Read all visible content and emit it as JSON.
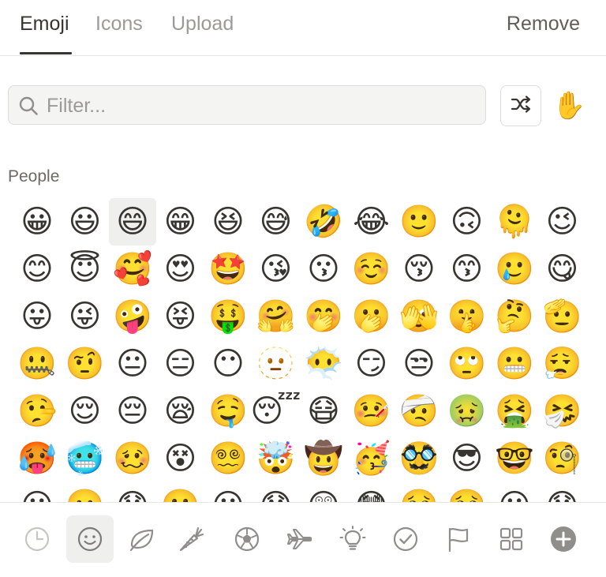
{
  "tabs": {
    "emoji": "Emoji",
    "icons": "Icons",
    "upload": "Upload",
    "remove": "Remove",
    "active": "emoji"
  },
  "filter": {
    "placeholder": "Filter...",
    "search_icon": "search-icon",
    "shuffle_icon": "shuffle-icon",
    "skin_tone_icon": "raised-hand-icon",
    "skin_tone_glyph": "✋"
  },
  "section": {
    "label": "People"
  },
  "emojis": [
    "😀",
    "😃",
    "😄",
    "😁",
    "😆",
    "😅",
    "🤣",
    "😂",
    "🙂",
    "🙃",
    "🫠",
    "😉",
    "😊",
    "😇",
    "🥰",
    "😍",
    "🤩",
    "😘",
    "😗",
    "☺️",
    "😚",
    "😙",
    "🥲",
    "😋",
    "😛",
    "😜",
    "🤪",
    "😝",
    "🤑",
    "🤗",
    "🤭",
    "🫢",
    "🫣",
    "🤫",
    "🤔",
    "🫡",
    "🤐",
    "🤨",
    "😐",
    "😑",
    "😶",
    "🫥",
    "😶‍🌫️",
    "😏",
    "😒",
    "🙄",
    "😬",
    "😮‍💨",
    "🤥",
    "😌",
    "😔",
    "😪",
    "🤤",
    "😴",
    "😷",
    "🤒",
    "🤕",
    "🤢",
    "🤮",
    "🤧",
    "🥵",
    "🥶",
    "🥴",
    "😵",
    "😵‍💫",
    "🤯",
    "🤠",
    "🥳",
    "🥸",
    "😎",
    "🤓",
    "🧐",
    "😕",
    "🫤",
    "😟",
    "🙁",
    "😮",
    "😯",
    "😲",
    "😳",
    "🥺",
    "🥹",
    "😦",
    "😧"
  ],
  "hovered_index": 2,
  "categories": [
    {
      "name": "recent",
      "icon": "clock-icon"
    },
    {
      "name": "people",
      "icon": "smiley-icon",
      "active": true
    },
    {
      "name": "nature",
      "icon": "leaf-icon"
    },
    {
      "name": "food",
      "icon": "carrot-icon"
    },
    {
      "name": "activity",
      "icon": "soccer-ball-icon"
    },
    {
      "name": "travel",
      "icon": "airplane-icon"
    },
    {
      "name": "objects",
      "icon": "lightbulb-icon"
    },
    {
      "name": "symbols",
      "icon": "checkmark-circle-icon"
    },
    {
      "name": "flags",
      "icon": "flag-icon"
    },
    {
      "name": "custom",
      "icon": "grid-icon"
    },
    {
      "name": "add",
      "icon": "plus-circle-icon"
    }
  ],
  "colors": {
    "text": "#37352f",
    "muted": "#9b9a97",
    "border": "#e8e8e6",
    "icon": "#8f8e8b",
    "active_bg": "#efefee"
  }
}
